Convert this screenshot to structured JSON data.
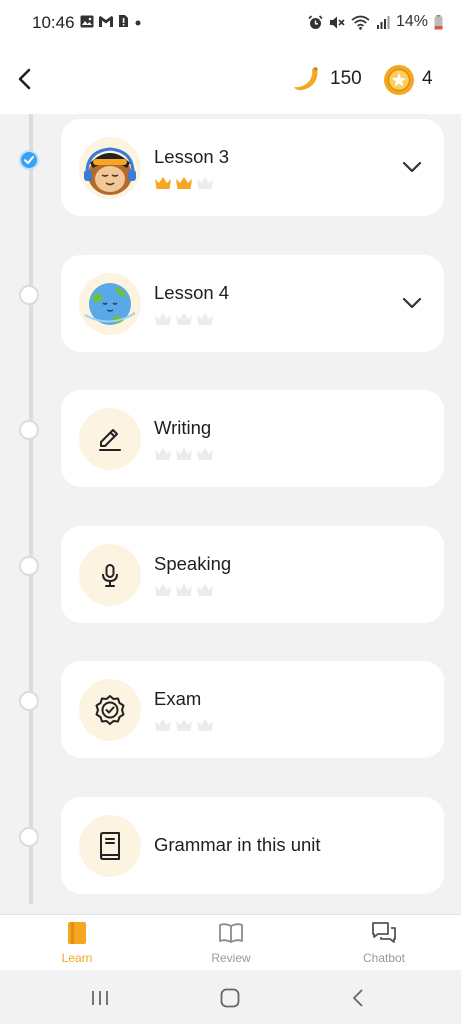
{
  "status_bar": {
    "time": "10:46",
    "battery": "14%",
    "left_icons": [
      "gallery-icon",
      "gmail-icon",
      "sim-alert-icon",
      "dot-icon"
    ],
    "right_icons": [
      "alarm-icon",
      "mute-icon",
      "wifi-icon",
      "signal-icon",
      "battery-icon"
    ]
  },
  "header": {
    "back_icon": "chevron-left-icon",
    "banana_count": "150",
    "coin_count": "4"
  },
  "colors": {
    "accent": "#f5a623",
    "done_node": "#3aa2ee",
    "card_bg": "#ffffff",
    "icon_bg": "#fdf3e1"
  },
  "lessons": [
    {
      "title": "Lesson 3",
      "icon": "monkey-headphones-icon",
      "crowns_earned": 2,
      "crowns_total": 3,
      "completed": true,
      "expandable": true
    },
    {
      "title": "Lesson 4",
      "icon": "earth-icon",
      "crowns_earned": 0,
      "crowns_total": 3,
      "completed": false,
      "expandable": true
    },
    {
      "title": "Writing",
      "icon": "pencil-icon",
      "crowns_earned": 0,
      "crowns_total": 3,
      "completed": false,
      "expandable": false
    },
    {
      "title": "Speaking",
      "icon": "microphone-icon",
      "crowns_earned": 0,
      "crowns_total": 3,
      "completed": false,
      "expandable": false
    },
    {
      "title": "Exam",
      "icon": "badge-check-icon",
      "crowns_earned": 0,
      "crowns_total": 3,
      "completed": false,
      "expandable": false
    },
    {
      "title": "Grammar in this unit",
      "icon": "book-icon",
      "completed": false,
      "expandable": false
    }
  ],
  "bottom_nav": {
    "learn": "Learn",
    "review": "Review",
    "chatbot": "Chatbot",
    "active": "Learn"
  },
  "system_nav": [
    "recents-icon",
    "home-icon",
    "back-icon"
  ]
}
